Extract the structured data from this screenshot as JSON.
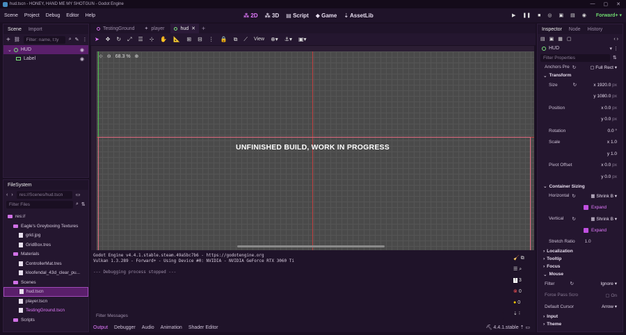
{
  "window": {
    "title": "hud.tscn - HONEY, HAND ME MY SHOTGUN - Godot Engine"
  },
  "menu": [
    "Scene",
    "Project",
    "Debug",
    "Editor",
    "Help"
  ],
  "workspaces": [
    "2D",
    "3D",
    "Script",
    "Game",
    "AssetLib"
  ],
  "renderer": "Forward+",
  "scene_panel": {
    "tabs": [
      "Scene",
      "Import"
    ],
    "filter_placeholder": "Filter: name, t:ty",
    "nodes": [
      "HUD",
      "Label"
    ]
  },
  "filesystem": {
    "title": "FileSystem",
    "path": "res://Scenes/hud.tscn",
    "filter_placeholder": "Filter Files",
    "items": [
      {
        "name": "res://",
        "kind": "folder",
        "indent": 0
      },
      {
        "name": "Eagle's Greyboxing Textures",
        "kind": "folder",
        "indent": 1
      },
      {
        "name": "grid.jpg",
        "kind": "file",
        "indent": 2
      },
      {
        "name": "GridBox.tres",
        "kind": "file",
        "indent": 2
      },
      {
        "name": "Materials",
        "kind": "folder",
        "indent": 1
      },
      {
        "name": "ControllerMat.tres",
        "kind": "file",
        "indent": 2
      },
      {
        "name": "kloofendal_43d_clear_pu...",
        "kind": "file",
        "indent": 2
      },
      {
        "name": "Scenes",
        "kind": "folder",
        "indent": 1
      },
      {
        "name": "hud.tscn",
        "kind": "file",
        "indent": 2,
        "sel": true
      },
      {
        "name": "player.tscn",
        "kind": "file",
        "indent": 2
      },
      {
        "name": "TestingGround.tscn",
        "kind": "file",
        "indent": 2
      },
      {
        "name": "Scripts",
        "kind": "folder",
        "indent": 1
      }
    ]
  },
  "doc_tabs": [
    "TestingGround",
    "player",
    "hud"
  ],
  "toolbar": {
    "view_label": "View"
  },
  "viewport": {
    "zoom": "68.3 %",
    "label_text": "UNFINISHED BUILD, WORK IN PROGRESS"
  },
  "output": {
    "lines": [
      "Godot Engine v4.4.1.stable.steam.49a5bc7b6 - https://godotengine.org",
      "Vulkan 1.3.289 - Forward+ - Using Device #0: NVIDIA - NVIDIA GeForce RTX 3060 Ti",
      "",
      "--- Debugging process stopped ---"
    ],
    "filter_placeholder": "Filter Messages",
    "counts": [
      "3",
      "0",
      "0"
    ],
    "tabs": [
      "Output",
      "Debugger",
      "Audio",
      "Animation",
      "Shader Editor"
    ],
    "version": "4.4.1.stable"
  },
  "inspector": {
    "tabs": [
      "Inspector",
      "Node",
      "History"
    ],
    "node": "HUD",
    "filter_placeholder": "Filter Properties",
    "anchors_label": "Anchors Pre",
    "anchors_value": "Full Rect",
    "transform": "Transform",
    "size_label": "Size",
    "size_x": "1920.0",
    "size_y": "1080.0",
    "position_label": "Position",
    "pos_x": "0.0",
    "pos_y": "0.0",
    "rotation_label": "Rotation",
    "rotation": "0.0",
    "scale_label": "Scale",
    "scale_x": "1.0",
    "scale_y": "1.0",
    "pivot_label": "Pivot Offset",
    "pivot_x": "0.0",
    "pivot_y": "0.0",
    "container": "Container Sizing",
    "horizontal_label": "Horizontal",
    "horizontal": "Shrink B",
    "expand": "Expand",
    "vertical_label": "Vertical",
    "vertical": "Shrink B",
    "stretch_label": "Stretch Ratio",
    "stretch": "1.0",
    "sections": [
      "Localization",
      "Tooltip",
      "Focus",
      "Mouse"
    ],
    "filter_label": "Filter",
    "filter_value": "Ignore",
    "force_label": "Force Pass Scro",
    "force_value": "On",
    "cursor_label": "Default Cursor",
    "cursor_value": "Arrow",
    "bottom_sections": [
      "Input",
      "Theme"
    ],
    "unit": "px"
  }
}
